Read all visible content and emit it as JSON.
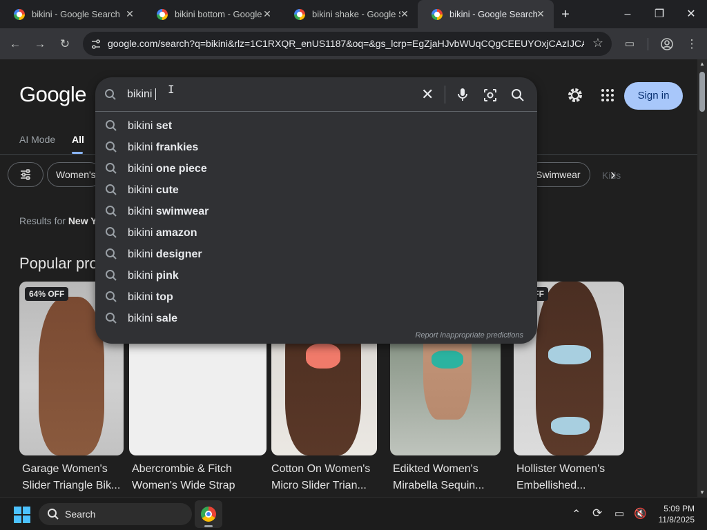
{
  "tabs": [
    {
      "title": "bikini - Google Search",
      "active": false
    },
    {
      "title": "bikini bottom - Google S",
      "active": false
    },
    {
      "title": "bikini shake - Google Se",
      "active": false
    },
    {
      "title": "bikini - Google Search",
      "active": true
    }
  ],
  "window": {
    "minimize": "–",
    "restore": "❐",
    "close": "✕",
    "new_tab": "+"
  },
  "toolbar": {
    "url": "google.com/search?q=bikini&rlz=1C1RXQR_enUS1187&oq=&gs_lcrp=EgZjaHJvbWUqCQgCEEUYOxjCAzIJCA..."
  },
  "header": {
    "logo": "Google",
    "sign_in": "Sign in"
  },
  "nav_tabs": [
    {
      "label": "AI Mode",
      "active": false
    },
    {
      "label": "All",
      "active": true
    }
  ],
  "chips": {
    "womens": "Women's",
    "swimwear": "Swimwear",
    "faded": "Kids"
  },
  "results_for": {
    "prefix": "Results for ",
    "place": "New Y"
  },
  "section": {
    "title": "Popular pro"
  },
  "products": [
    {
      "badge": "64% OFF",
      "line1": "Garage Women's",
      "line2": "Slider Triangle Bik..."
    },
    {
      "badge": "",
      "line1": "Abercrombie & Fitch",
      "line2": "Women's Wide Strap"
    },
    {
      "badge": "",
      "line1": "Cotton On Women's",
      "line2": "Micro Slider Trian..."
    },
    {
      "badge": "",
      "line1": "Edikted Women's",
      "line2": "Mirabella Sequin..."
    },
    {
      "badge": "% OFF",
      "line1": "Hollister Women's",
      "line2": "Embellished..."
    }
  ],
  "search": {
    "query": "bikini ",
    "suggestions": [
      {
        "prefix": "bikini ",
        "bold": "set"
      },
      {
        "prefix": "bikini ",
        "bold": "frankies"
      },
      {
        "prefix": "bikini ",
        "bold": "one piece"
      },
      {
        "prefix": "bikini ",
        "bold": "cute"
      },
      {
        "prefix": "bikini ",
        "bold": "swimwear"
      },
      {
        "prefix": "bikini ",
        "bold": "amazon"
      },
      {
        "prefix": "bikini ",
        "bold": "designer"
      },
      {
        "prefix": "bikini ",
        "bold": "pink"
      },
      {
        "prefix": "bikini ",
        "bold": "top"
      },
      {
        "prefix": "bikini ",
        "bold": "sale"
      }
    ],
    "report": "Report inappropriate predictions"
  },
  "taskbar": {
    "search_label": "Search",
    "time": "5:09 PM",
    "date": "11/8/2025"
  },
  "colors": {
    "accent": "#8ab4f8",
    "signin_bg": "#a8c7fa",
    "signin_text": "#062e6f"
  }
}
